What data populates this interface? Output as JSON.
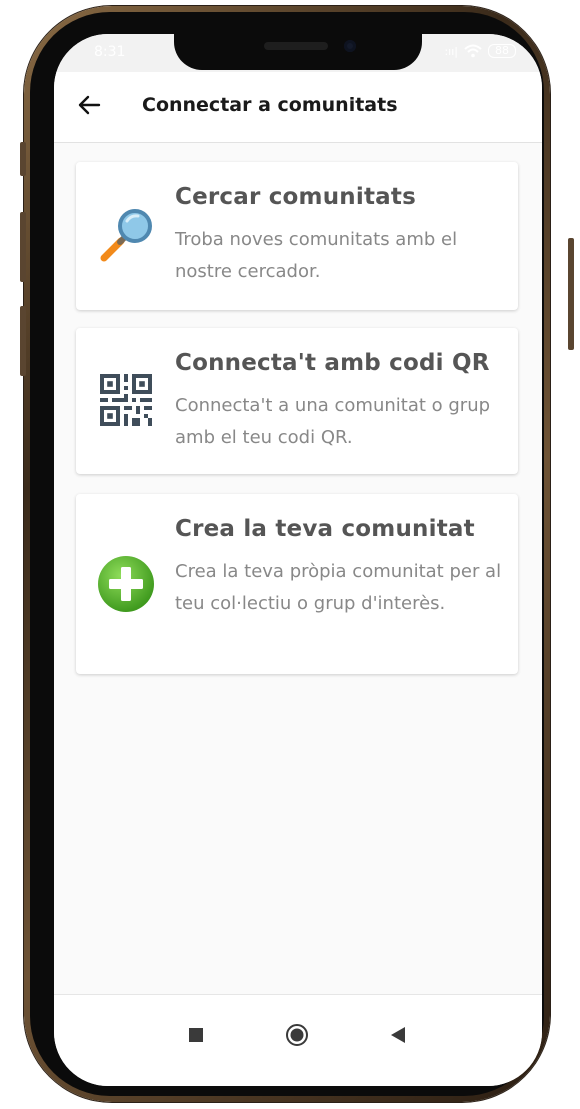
{
  "status_bar": {
    "time": "8:31",
    "signal": ":ıı|",
    "battery": "88"
  },
  "app_bar": {
    "back_icon": "arrow-left-icon",
    "title": "Connectar a comunitats"
  },
  "options": [
    {
      "icon": "magnifier-icon",
      "title": "Cercar comunitats",
      "description": "Troba noves comunitats amb el nostre cercador."
    },
    {
      "icon": "qr-code-icon",
      "title": "Connecta't amb codi QR",
      "description": "Connecta't a una comunitat o grup amb el teu codi QR."
    },
    {
      "icon": "plus-circle-icon",
      "title": "Crea la teva comunitat",
      "description": "Crea la teva pròpia comunitat per al teu col·lectiu o grup d'interès."
    }
  ],
  "nav_bar": {
    "icons": [
      "square-icon",
      "circle-icon",
      "triangle-back-icon"
    ]
  },
  "colors": {
    "card_title": "#555555",
    "card_desc": "#888888",
    "plus_green": "#5cb82e",
    "magnifier_handle": "#f28a1a",
    "magnifier_lens": "#8fc8e8",
    "qr": "#3f4d5a"
  }
}
